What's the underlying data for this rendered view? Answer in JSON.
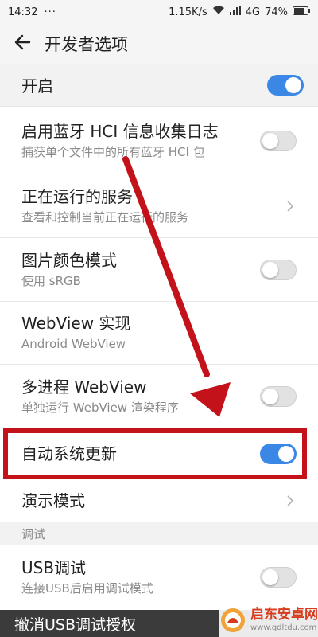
{
  "status_bar": {
    "time": "14:32",
    "dots": "···",
    "speed": "1.15K/s",
    "network": "4G",
    "battery": "74%"
  },
  "header": {
    "title": "开发者选项"
  },
  "master_toggle": {
    "label": "开启",
    "on": true
  },
  "settings": [
    {
      "title": "启用蓝牙 HCI 信息收集日志",
      "subtitle": "捕获单个文件中的所有蓝牙 HCI 包",
      "control": "toggle",
      "on": false
    },
    {
      "title": "正在运行的服务",
      "subtitle": "查看和控制当前正在运行的服务",
      "control": "chevron"
    },
    {
      "title": "图片颜色模式",
      "subtitle": "使用 sRGB",
      "control": "toggle",
      "on": false
    },
    {
      "title": "WebView 实现",
      "subtitle": "Android WebView",
      "control": "none"
    },
    {
      "title": "多进程 WebView",
      "subtitle": "单独运行 WebView 渲染程序",
      "control": "toggle",
      "on": false
    },
    {
      "title": "自动系统更新",
      "control": "toggle",
      "on": true
    },
    {
      "title": "演示模式",
      "control": "chevron"
    }
  ],
  "debug_section": {
    "header": "调试",
    "items": [
      {
        "title": "USB调试",
        "subtitle": "连接USB后启用调试模式",
        "control": "toggle",
        "on": false
      }
    ]
  },
  "bottom_item": {
    "label": "撤消USB调试授权"
  },
  "watermark": {
    "title": "启东安卓网",
    "url": "www.qdltdu.com"
  },
  "colors": {
    "toggle_on": "#3a87e6",
    "annotation_red": "#c4121a",
    "subtitle_gray": "#8a8a8a"
  }
}
